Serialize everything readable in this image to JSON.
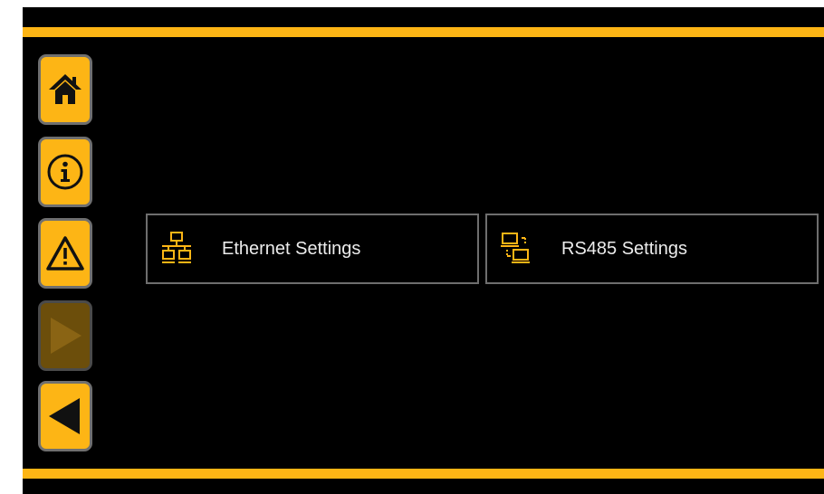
{
  "theme": {
    "accent": "#fdb515",
    "accent_disabled": "#6c4e0b",
    "background": "#000000",
    "tile_border": "#6e6e6e",
    "text": "#ececec"
  },
  "sidebar": {
    "buttons": [
      {
        "name": "home",
        "icon": "home-icon",
        "enabled": true
      },
      {
        "name": "info",
        "icon": "info-icon",
        "enabled": true
      },
      {
        "name": "alarms",
        "icon": "warning-icon",
        "enabled": true
      },
      {
        "name": "forward",
        "icon": "play-right-icon",
        "enabled": false
      },
      {
        "name": "back",
        "icon": "play-left-icon",
        "enabled": true
      }
    ]
  },
  "menu": {
    "items": [
      {
        "label": "Ethernet Settings",
        "icon": "ethernet-network-icon"
      },
      {
        "label": "RS485 Settings",
        "icon": "rs485-serial-icon"
      }
    ]
  }
}
